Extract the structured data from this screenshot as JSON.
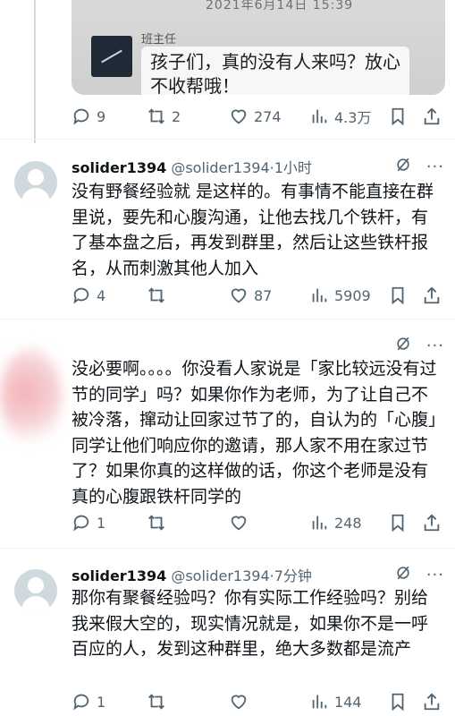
{
  "quoted_image": {
    "date": "2021年6月14日 15:39",
    "sender": "班主任",
    "message": "孩子们，真的没有人来吗？放心不收帮哦！"
  },
  "top_actions": {
    "replies": "9",
    "reposts": "2",
    "likes": "274",
    "views": "4.3万"
  },
  "tweets": [
    {
      "display_name": "solider1394",
      "handle_time": "@solider1394·1小时",
      "text": "没有野餐经验就 是这样的。有事情不能直接在群里说，要先和心腹沟通，让他去找几个铁杆，有了基本盘之后，再发到群里，然后让这些铁杆报名，从而刺激其他人加入",
      "replies": "4",
      "reposts": "",
      "likes": "87",
      "views": "5909"
    },
    {
      "display_name": "",
      "handle_time": "",
      "text": "没必要啊。。。。你没看人家说是「家比较远没有过节的同学」吗？如果你作为老师，为了让自己不被冷落，撺动让回家过节了的，自认为的「心腹」同学让他们响应你的邀请，那人家不用在家过节了？如果你真的这样做的话，你这个老师是没有真的心腹跟铁杆同学的",
      "replies": "1",
      "reposts": "",
      "likes": "",
      "views": "248"
    },
    {
      "display_name": "solider1394",
      "handle_time": "@solider1394·7分钟",
      "text": "那你有聚餐经验吗？你有实际工作经验吗？别给我来假大空的，现实情况就是，如果你不是一呼百应的人，发到这种群里，绝大多数都是流产",
      "replies": "1",
      "reposts": "",
      "likes": "",
      "views": "144"
    }
  ]
}
